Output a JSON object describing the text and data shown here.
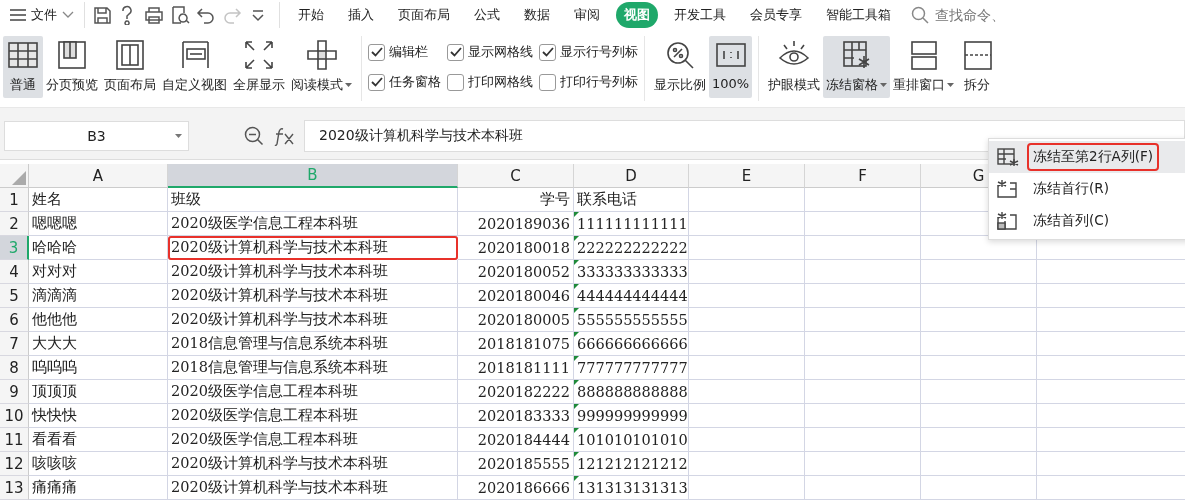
{
  "file_menu": {
    "label": "文件"
  },
  "quick_access": [
    {
      "kind": "save",
      "disabled": false
    },
    {
      "kind": "format",
      "disabled": false
    },
    {
      "kind": "print",
      "disabled": false
    },
    {
      "kind": "preview",
      "disabled": false
    },
    {
      "kind": "undo",
      "disabled": false
    },
    {
      "kind": "redo",
      "disabled": true
    },
    {
      "kind": "more",
      "disabled": false
    }
  ],
  "tabs": [
    {
      "label": "开始",
      "selected": false
    },
    {
      "label": "插入",
      "selected": false
    },
    {
      "label": "页面布局",
      "selected": false
    },
    {
      "label": "公式",
      "selected": false
    },
    {
      "label": "数据",
      "selected": false
    },
    {
      "label": "审阅",
      "selected": false
    },
    {
      "label": "视图",
      "selected": true
    },
    {
      "label": "开发工具",
      "selected": false
    },
    {
      "label": "会员专享",
      "selected": false
    },
    {
      "label": "智能工具箱",
      "selected": false
    }
  ],
  "search": {
    "placeholder": "查找命令、"
  },
  "view_buttons": [
    {
      "kind": "grid",
      "label": "普通",
      "selected": true,
      "dropdown": false
    },
    {
      "kind": "pagebreak",
      "label": "分页预览",
      "selected": false,
      "dropdown": false
    },
    {
      "kind": "layout",
      "label": "页面布局",
      "selected": false,
      "dropdown": false
    },
    {
      "kind": "custom",
      "label": "自定义视图",
      "selected": false,
      "dropdown": false
    },
    {
      "kind": "fullscreen",
      "label": "全屏显示",
      "selected": false,
      "dropdown": false
    },
    {
      "kind": "reading",
      "label": "阅读模式",
      "selected": false,
      "dropdown": true
    }
  ],
  "checkboxes": [
    {
      "label": "编辑栏",
      "checked": true
    },
    {
      "label": "显示网格线",
      "checked": true
    },
    {
      "label": "显示行号列标",
      "checked": true
    },
    {
      "label": "任务窗格",
      "checked": true
    },
    {
      "label": "打印网格线",
      "checked": false
    },
    {
      "label": "打印行号列标",
      "checked": false
    }
  ],
  "zoom_buttons": [
    {
      "kind": "zoom",
      "label": "显示比例",
      "selected": false
    },
    {
      "kind": "actual",
      "label": "100%",
      "selected": true
    }
  ],
  "window_buttons": [
    {
      "kind": "eye",
      "label": "护眼模式",
      "selected": false,
      "dropdown": false
    },
    {
      "kind": "freeze",
      "label": "冻结窗格",
      "selected": true,
      "dropdown": true
    },
    {
      "kind": "arrange",
      "label": "重排窗口",
      "selected": false,
      "dropdown": true
    },
    {
      "kind": "split",
      "label": "拆分",
      "selected": false,
      "dropdown": false
    }
  ],
  "freeze_menu": [
    {
      "kind": "cell",
      "label": "冻结至第2行A列(F)",
      "selected": true,
      "red_outline": true
    },
    {
      "kind": "row",
      "label": "冻结首行(R)",
      "selected": false,
      "red_outline": false
    },
    {
      "kind": "col",
      "label": "冻结首列(C)",
      "selected": false,
      "red_outline": false
    }
  ],
  "name_box": {
    "value": "B3"
  },
  "formula": {
    "value": "2020级计算机科学与技术本科班"
  },
  "columns": [
    {
      "letter": "A",
      "selected": false,
      "kind": "text"
    },
    {
      "letter": "B",
      "selected": true,
      "kind": "text"
    },
    {
      "letter": "C",
      "selected": false,
      "kind": "number"
    },
    {
      "letter": "D",
      "selected": false,
      "kind": "textnum"
    },
    {
      "letter": "E",
      "selected": false,
      "kind": "text"
    },
    {
      "letter": "F",
      "selected": false,
      "kind": "text"
    },
    {
      "letter": "G",
      "selected": false,
      "kind": "text"
    }
  ],
  "rows": [
    {
      "number": "1",
      "selected": false,
      "cells": [
        "姓名",
        "班级",
        "学号",
        "联系电话"
      ],
      "red_outline": false
    },
    {
      "number": "2",
      "selected": false,
      "cells": [
        "嗯嗯嗯",
        "2020级医学信息工程本科班",
        "2020189036",
        "111111111111"
      ],
      "red_outline": false
    },
    {
      "number": "3",
      "selected": true,
      "cells": [
        "哈哈哈",
        "2020级计算机科学与技术本科班",
        "2020180018",
        "222222222222"
      ],
      "red_outline": true
    },
    {
      "number": "4",
      "selected": false,
      "cells": [
        "对对对",
        "2020级计算机科学与技术本科班",
        "2020180052",
        "333333333333"
      ],
      "red_outline": false
    },
    {
      "number": "5",
      "selected": false,
      "cells": [
        "滴滴滴",
        "2020级计算机科学与技术本科班",
        "2020180046",
        "444444444444"
      ],
      "red_outline": false
    },
    {
      "number": "6",
      "selected": false,
      "cells": [
        "他他他",
        "2020级计算机科学与技术本科班",
        "2020180005",
        "555555555555"
      ],
      "red_outline": false
    },
    {
      "number": "7",
      "selected": false,
      "cells": [
        "大大大",
        "2018信息管理与信息系统本科班",
        "2018181075",
        "666666666666"
      ],
      "red_outline": false
    },
    {
      "number": "8",
      "selected": false,
      "cells": [
        "呜呜呜",
        "2018信息管理与信息系统本科班",
        "2018181111",
        "777777777777"
      ],
      "red_outline": false
    },
    {
      "number": "9",
      "selected": false,
      "cells": [
        "顶顶顶",
        "2020级医学信息工程本科班",
        "2020182222",
        "888888888888"
      ],
      "red_outline": false
    },
    {
      "number": "10",
      "selected": false,
      "cells": [
        "快快快",
        "2020级医学信息工程本科班",
        "2020183333",
        "999999999999"
      ],
      "red_outline": false
    },
    {
      "number": "11",
      "selected": false,
      "cells": [
        "看看看",
        "2020级医学信息工程本科班",
        "2020184444",
        "101010101010"
      ],
      "red_outline": false
    },
    {
      "number": "12",
      "selected": false,
      "cells": [
        "咳咳咳",
        "2020级计算机科学与技术本科班",
        "2020185555",
        "121212121212"
      ],
      "red_outline": false
    },
    {
      "number": "13",
      "selected": false,
      "cells": [
        "痛痛痛",
        "2020级计算机科学与技术本科班",
        "2020186666",
        "131313131313"
      ],
      "red_outline": false
    }
  ]
}
